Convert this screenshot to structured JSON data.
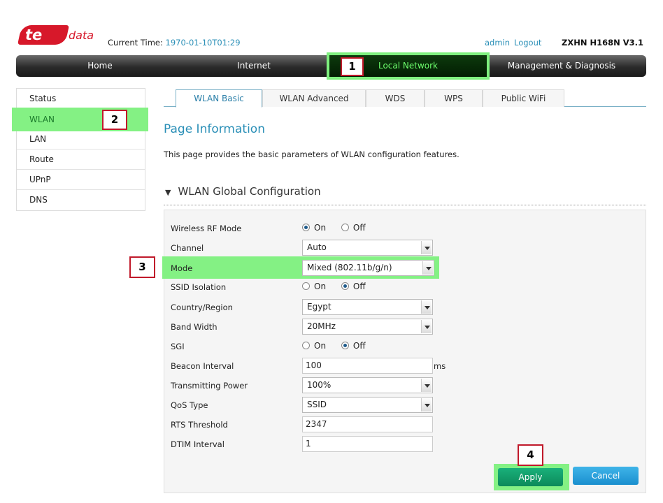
{
  "header": {
    "logo_text_1": "te",
    "logo_text_2": "data",
    "current_time_label": "Current Time:",
    "current_time_value": "1970-01-10T01:29",
    "user": "admin",
    "logout": "Logout",
    "model": "ZXHN H168N V3.1"
  },
  "nav": {
    "items": [
      "Home",
      "Internet",
      "Local Network",
      "Management & Diagnosis"
    ],
    "active": "Local Network"
  },
  "sidebar": {
    "items": [
      "Status",
      "WLAN",
      "LAN",
      "Route",
      "UPnP",
      "DNS"
    ],
    "active": "WLAN"
  },
  "tabs": {
    "items": [
      "WLAN Basic",
      "WLAN Advanced",
      "WDS",
      "WPS",
      "Public WiFi"
    ],
    "active": "WLAN Basic"
  },
  "page": {
    "title": "Page Information",
    "description": "This page provides the basic parameters of WLAN configuration features.",
    "section_title": "WLAN Global Configuration"
  },
  "form": {
    "wireless_rf_mode": {
      "label": "Wireless RF Mode",
      "on": "On",
      "off": "Off",
      "value": "On"
    },
    "channel": {
      "label": "Channel",
      "value": "Auto"
    },
    "mode": {
      "label": "Mode",
      "value": "Mixed (802.11b/g/n)"
    },
    "ssid_isolation": {
      "label": "SSID Isolation",
      "on": "On",
      "off": "Off",
      "value": "Off"
    },
    "country_region": {
      "label": "Country/Region",
      "value": "Egypt"
    },
    "band_width": {
      "label": "Band Width",
      "value": "20MHz"
    },
    "sgi": {
      "label": "SGI",
      "on": "On",
      "off": "Off",
      "value": "Off"
    },
    "beacon_interval": {
      "label": "Beacon Interval",
      "value": "100",
      "unit": "ms"
    },
    "transmitting_power": {
      "label": "Transmitting Power",
      "value": "100%"
    },
    "qos_type": {
      "label": "QoS Type",
      "value": "SSID"
    },
    "rts_threshold": {
      "label": "RTS Threshold",
      "value": "2347"
    },
    "dtim_interval": {
      "label": "DTIM Interval",
      "value": "1"
    }
  },
  "buttons": {
    "apply": "Apply",
    "cancel": "Cancel"
  },
  "annotations": {
    "b1": "1",
    "b2": "2",
    "b3": "3",
    "b4": "4"
  },
  "colors": {
    "accent": "#2a8fb7",
    "highlight": "#84f184",
    "brand": "#d7182a",
    "annotation_border": "#c0192a"
  }
}
